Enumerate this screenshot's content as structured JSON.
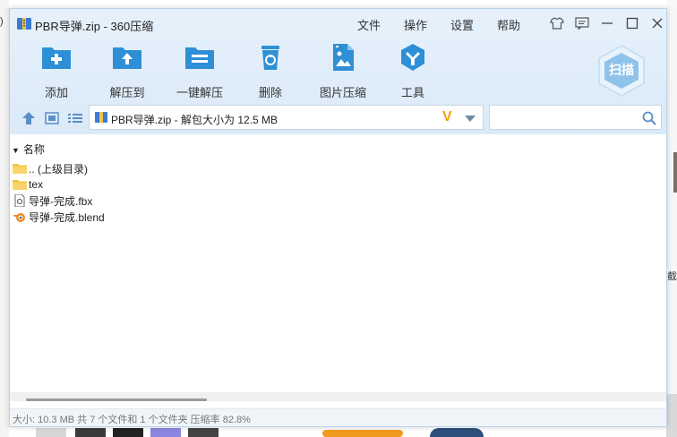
{
  "background": {
    "left_fragment": ")",
    "right_fragment": "截"
  },
  "window": {
    "title": "PBR导弹.zip - 360压缩",
    "menu": [
      "文件",
      "操作",
      "设置",
      "帮助"
    ],
    "controls": [
      "skin-icon",
      "message-icon",
      "minimize-icon",
      "maximize-icon",
      "close-icon"
    ]
  },
  "toolbar": {
    "items": [
      {
        "label": "添加",
        "icon": "add-folder-icon"
      },
      {
        "label": "解压到",
        "icon": "extract-to-icon"
      },
      {
        "label": "一键解压",
        "icon": "one-click-extract-icon"
      },
      {
        "label": "删除",
        "icon": "delete-icon"
      },
      {
        "label": "图片压缩",
        "icon": "image-compress-icon"
      },
      {
        "label": "工具",
        "icon": "tools-icon"
      }
    ],
    "scan_label": "扫描"
  },
  "address": {
    "path": "PBR导弹.zip - 解包大小为 12.5 MB",
    "badge": "V"
  },
  "search": {
    "value": "",
    "placeholder": ""
  },
  "list": {
    "column_header": "名称",
    "sort_arrow": "▼",
    "rows": [
      {
        "name": ".. (上级目录)",
        "icon": "folder-icon"
      },
      {
        "name": "tex",
        "icon": "folder-icon"
      },
      {
        "name": "导弹-完成.fbx",
        "icon": "fbx-file-icon"
      },
      {
        "name": "导弹-完成.blend",
        "icon": "blender-file-icon"
      }
    ]
  },
  "status": {
    "text": "大小: 10.3 MB 共 7 个文件和 1 个文件夹 压缩率 82.8%"
  },
  "colors": {
    "accent": "#2e8fd6",
    "titlebar": "#e6f1fb",
    "folder": "#f5c342",
    "v_badge": "#f0a016"
  }
}
